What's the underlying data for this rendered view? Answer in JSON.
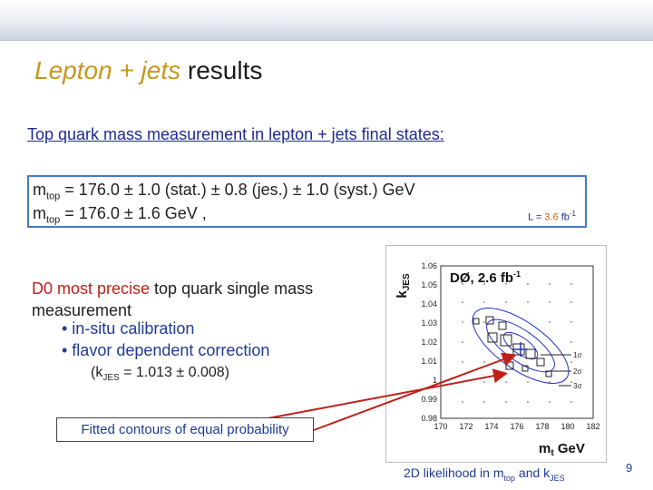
{
  "title": {
    "accent": "Lepton + jets",
    "rest": " results"
  },
  "subtitle": "Top quark mass measurement in lepton + jets final states:",
  "result": {
    "line1_m": "m",
    "line1_sub": "top",
    "line1_rest": " = 176.0  ±  1.0 (stat.)  ±  0.8 (jes.)  ±  1.0 (syst.) GeV",
    "line2_m": "m",
    "line2_sub": "top",
    "line2_rest": " = 176.0 ±  1.6 GeV ,",
    "lumi_prefix": "L = ",
    "lumi_value": "3.6",
    "lumi_unit": " fb",
    "lumi_exp": "-1"
  },
  "d0": {
    "lead": "D0 most precise",
    "tail": " top quark single mass measurement",
    "bullets": [
      "•  in-situ calibration",
      "•  flavor dependent correction"
    ],
    "kjes_k": "(k",
    "kjes_sub": "JES",
    "kjes_rest": " = 1.013  ±  0.008)"
  },
  "fitted_label": "Fitted contours of equal probability",
  "plot": {
    "y_title_k": "k",
    "y_title_sub": "JES",
    "x_title_m": "m",
    "x_title_sub": "t",
    "x_title_unit": " GeV",
    "experiment": "DØ, 2.6 fb",
    "experiment_exp": "-1",
    "y_ticks": [
      "1.06",
      "1.05",
      "1.04",
      "1.03",
      "1.02",
      "1.01",
      "1",
      "0.99",
      "0.98"
    ],
    "x_ticks": [
      "170",
      "172",
      "174",
      "176",
      "178",
      "180",
      "182"
    ],
    "sigma_labels": [
      "1σ",
      "2σ",
      "3σ"
    ]
  },
  "caption": {
    "pre": "2D likelihood in m",
    "sub1": "top",
    "mid": " and k",
    "sub2": "JES"
  },
  "page_number": "9",
  "colors": {
    "accent": "#c8961e",
    "link_blue": "#1f2a8c",
    "highlight_red": "#c0201a",
    "box_border": "#4a78c8",
    "contour_blue": "#2030c0"
  }
}
